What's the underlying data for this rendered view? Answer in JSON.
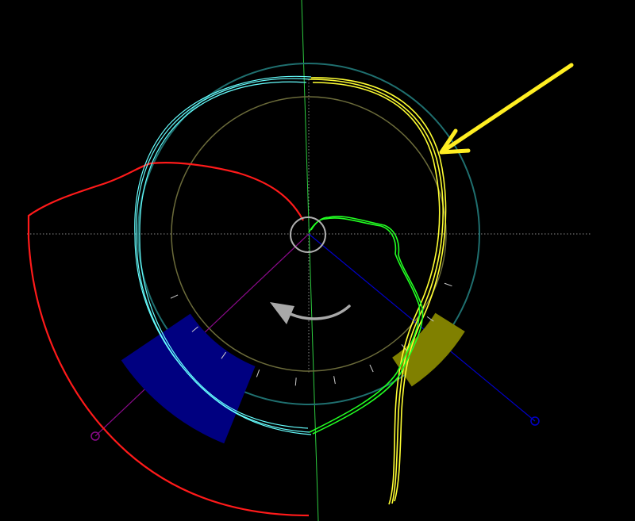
{
  "colors": {
    "background": "#000000",
    "crosshair": "#8a8a8a",
    "vertical_guide": "#2ecc40",
    "outer_ring": "#1f6f6f",
    "inner_ring": "#6b6b3a",
    "center_circle": "#b0b0b0",
    "red_trace": "#ff1a1a",
    "cyan_trace": "#66ffff",
    "yellow_trace": "#ffff33",
    "green_trace": "#22ff22",
    "blue_zone": "#000080",
    "olive_zone": "#808000",
    "blue_spoke": "#0000c8",
    "purple_spoke": "#8a0a8a",
    "rotation_arrow": "#a8a8a8",
    "pointer_arrow": "#ffee22",
    "tick_marks": "#cfcfcf"
  },
  "icons": {
    "rotation": "counterclockwise-arrow-icon",
    "pointer": "pointer-arrow-icon",
    "spoke_end": "circle-handle-icon"
  }
}
